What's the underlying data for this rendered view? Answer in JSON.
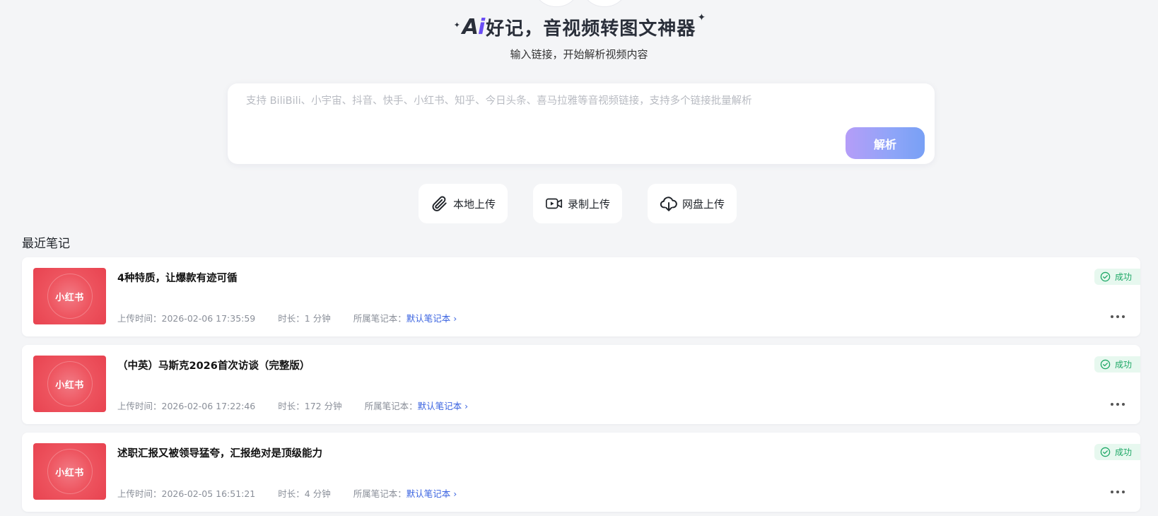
{
  "hero": {
    "logo_a": "A",
    "logo_i": "i",
    "title": "好记，音视频转图文神器",
    "subtitle": "输入链接，开始解析视频内容"
  },
  "input": {
    "value": "",
    "placeholder": "支持 BiliBili、小宇宙、抖音、快手、小红书、知乎、今日头条、喜马拉雅等音视频链接，支持多个链接批量解析",
    "parse_label": "解析"
  },
  "upload": [
    {
      "label": "本地上传",
      "icon": "paperclip-icon"
    },
    {
      "label": "录制上传",
      "icon": "video-record-icon"
    },
    {
      "label": "网盘上传",
      "icon": "cloud-download-icon"
    }
  ],
  "recent": {
    "title": "最近笔记",
    "notes": [
      {
        "thumb_text": "小红书",
        "title": "4种特质，让爆款有迹可循",
        "upload_time": "上传时间：2026-02-06 17:35:59",
        "duration": "时长：1 分钟",
        "notebook_label": "所属笔记本：",
        "notebook_name": "默认笔记本",
        "status": "成功"
      },
      {
        "thumb_text": "小红书",
        "title": "（中英）马斯克2026首次访谈（完整版）",
        "upload_time": "上传时间：2026-02-06 17:22:46",
        "duration": "时长：172 分钟",
        "notebook_label": "所属笔记本：",
        "notebook_name": "默认笔记本",
        "status": "成功"
      },
      {
        "thumb_text": "小红书",
        "title": "述职汇报又被领导猛夸，汇报绝对是顶级能力",
        "upload_time": "上传时间：2026-02-05 16:51:21",
        "duration": "时长：4 分钟",
        "notebook_label": "所属笔记本：",
        "notebook_name": "默认笔记本",
        "status": "成功"
      }
    ]
  },
  "colors": {
    "background": "#f4f5f7",
    "accent_purple": "#6a4df5",
    "link_blue": "#3a63e0",
    "success_green": "#1ea866",
    "thumb_red": "#ee5560"
  }
}
